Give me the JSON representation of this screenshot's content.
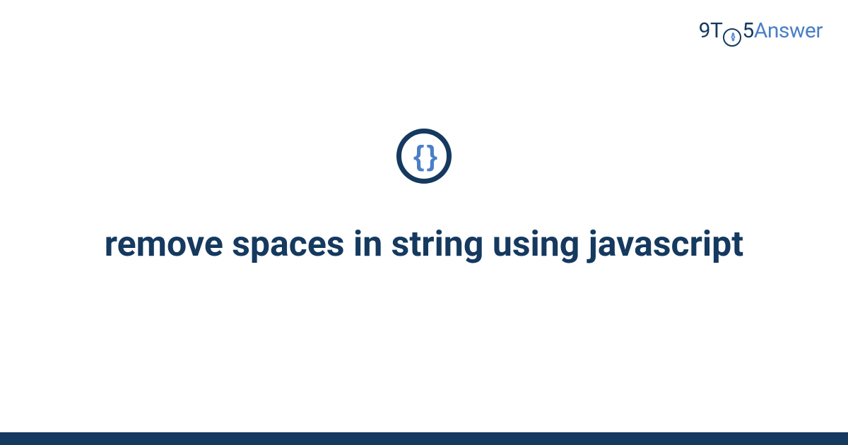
{
  "logo": {
    "part1": "9T",
    "part2": "5",
    "part3": "Answer",
    "inner_braces": "{}"
  },
  "icon": {
    "braces": "{ }"
  },
  "title": "remove spaces in string using javascript",
  "colors": {
    "dark_blue": "#15395f",
    "light_blue": "#4a7fc7",
    "background": "#ffffff"
  }
}
